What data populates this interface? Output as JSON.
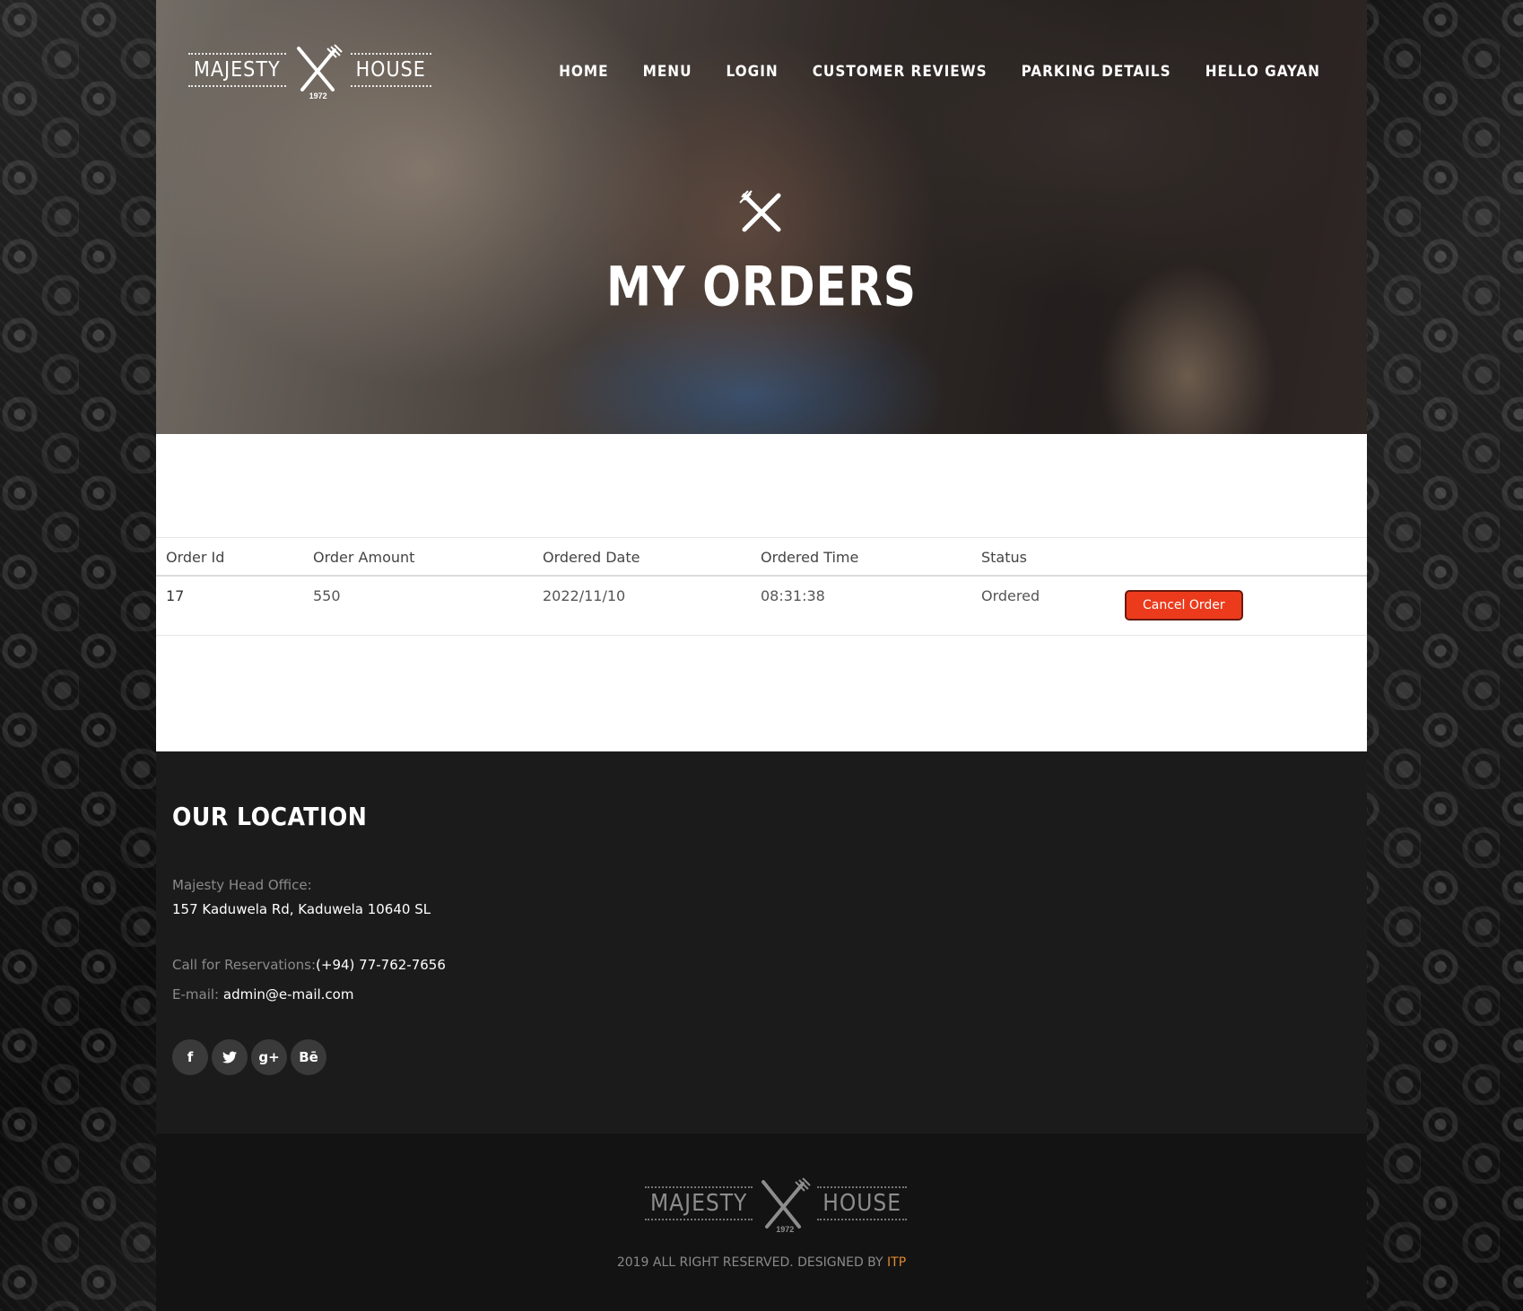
{
  "brand": {
    "word_left": "MAJESTY",
    "word_right": "HOUSE",
    "year": "1972"
  },
  "nav": {
    "items": [
      {
        "label": "HOME"
      },
      {
        "label": "MENU"
      },
      {
        "label": "LOGIN"
      },
      {
        "label": "CUSTOMER REVIEWS"
      },
      {
        "label": "PARKING DETAILS"
      },
      {
        "label": "HELLO GAYAN"
      }
    ]
  },
  "hero": {
    "icon": "crossed-fork-knife-icon",
    "title": "MY ORDERS"
  },
  "orders": {
    "headers": [
      "Order Id",
      "Order Amount",
      "Ordered Date",
      "Ordered Time",
      "Status"
    ],
    "rows": [
      {
        "order_id": "17",
        "amount": "550",
        "date": "2022/11/10",
        "time": "08:31:38",
        "status": "Ordered",
        "action_label": "Cancel Order"
      }
    ],
    "action_color": "#ec3b1c"
  },
  "location": {
    "title": "OUR LOCATION",
    "office_label": "Majesty Head Office:",
    "address": "157 Kaduwela Rd, Kaduwela 10640 SL",
    "reservation_label": "Call for Reservations:",
    "phone": "(+94) 77-762-7656",
    "email_label": "E-mail:",
    "email": "admin@e-mail.com",
    "socials": [
      {
        "icon": "facebook-icon",
        "glyph": "f"
      },
      {
        "icon": "twitter-icon",
        "glyph": "t"
      },
      {
        "icon": "google-plus-icon",
        "glyph": "g+"
      },
      {
        "icon": "behance-icon",
        "glyph": "Bē"
      }
    ]
  },
  "footer": {
    "copyright_prefix": "2019 ALL RIGHT RESERVED. DESIGNED BY ",
    "designer": "ITP",
    "designer_color": "#e0892f"
  }
}
